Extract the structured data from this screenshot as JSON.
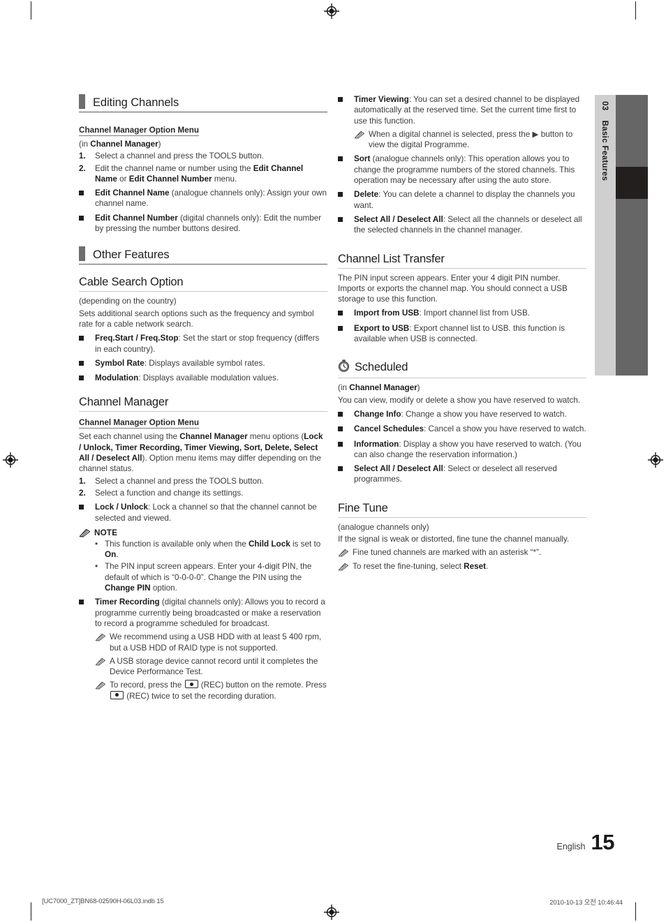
{
  "chapter_tab": {
    "number": "03",
    "label": "Basic Features"
  },
  "footer": {
    "language": "English",
    "page_number": "15",
    "print_file": "[UC7000_ZT]BN68-02590H-06L03.indb   15",
    "print_timestamp": "2010-10-13   오전 10:46:44"
  },
  "left_column": {
    "section1": {
      "heading": "Editing Channels",
      "opt_menu_title": "Channel Manager Option Menu",
      "in_line_pre": "(in ",
      "in_line_bold": "Channel Manager",
      "in_line_post": ")",
      "steps": [
        {
          "n": "1.",
          "html": "Select a channel and press the TOOLS button."
        },
        {
          "n": "2.",
          "html": "Edit the channel name or number using the <b>Edit Channel Name</b> or <b>Edit Channel Number</b> menu."
        }
      ],
      "bullets": [
        {
          "html": "<b>Edit Channel Name</b> (analogue channels only): Assign your own channel name."
        },
        {
          "html": "<b>Edit Channel Number</b> (digital channels only): Edit the number by pressing the number buttons desired."
        }
      ]
    },
    "section2": {
      "heading": "Other Features",
      "cable_search": {
        "title": "Cable Search Option",
        "paras": [
          "(depending on the country)",
          "Sets additional search options such as the frequency and symbol rate for a cable network search."
        ],
        "bullets": [
          {
            "html": "<b>Freq.Start / Freq.Stop</b>: Set the start or stop frequency (differs in each country)."
          },
          {
            "html": "<b>Symbol Rate</b>: Displays available symbol rates."
          },
          {
            "html": "<b>Modulation</b>: Displays available modulation values."
          }
        ]
      },
      "channel_manager": {
        "title": "Channel Manager",
        "opt_menu_title": "Channel Manager Option Menu",
        "intro_html": "Set each channel using the <b>Channel Manager</b> menu options (<b>Lock / Unlock, Timer Recording, Timer Viewing, Sort, Delete, Select All / Deselect All</b>). Option menu items may differ depending on the channel status.",
        "steps": [
          {
            "n": "1.",
            "html": "Select a channel and press the TOOLS button."
          },
          {
            "n": "2.",
            "html": "Select a function and change its settings."
          }
        ],
        "lock_bullet_html": "<b>Lock / Unlock</b>: Lock a channel so that the channel cannot be selected and viewed.",
        "note_label": "NOTE",
        "note_bullets": [
          {
            "html": "This function is available only when the <b>Child Lock</b> is set to <b>On</b>."
          },
          {
            "html": "The PIN input screen appears. Enter your 4-digit PIN, the default of which is “0-0-0-0”. Change the PIN using the <b>Change PIN</b> option."
          }
        ],
        "timer_recording_html": "<b>Timer Recording</b> (digital channels only): Allows you to record a programme currently being broadcasted or make a reservation to record a programme scheduled for broadcast.",
        "timer_recording_notes": [
          {
            "html": "We recommend using a USB HDD with at least 5 400 rpm, but a USB HDD of RAID type is not supported."
          },
          {
            "html": "A USB storage device cannot record until it completes the Device Performance Test."
          },
          {
            "html": "To record, press the <span class=\"reckey\"></span> (REC) button on the remote. Press <span class=\"reckey\"></span> (REC) twice to set the recording duration."
          }
        ]
      }
    }
  },
  "right_column": {
    "continued_bullets": [
      {
        "html": "<b>Timer Viewing</b>: You can set a desired channel to be displayed automatically at the reserved time. Set the current time first to use this function."
      },
      {
        "html": "<b>Sort</b> (analogue channels only): This operation allows you to change the programme numbers of the stored channels. This operation may be necessary after using the auto store."
      },
      {
        "html": "<b>Delete</b>: You can delete a channel to display the channels you want."
      },
      {
        "html": "<b>Select All / Deselect All</b>: Select all the channels or deselect all the selected channels in the channel manager."
      }
    ],
    "timer_viewing_note_html": "When a digital channel is selected, press the ▶ button to view the digital Programme.",
    "channel_list_transfer": {
      "title": "Channel List Transfer",
      "intro": "The PIN input screen appears. Enter your 4 digit PIN number. Imports or exports the channel map. You should connect a USB storage to use this function.",
      "bullets": [
        {
          "html": "<b>Import from USB</b>: Import channel list from USB."
        },
        {
          "html": "<b>Export to USB</b>: Export channel list to USB. this function is available when USB is connected."
        }
      ]
    },
    "scheduled": {
      "title": "Scheduled",
      "in_line_pre": "(in ",
      "in_line_bold": "Channel Manager",
      "in_line_post": ")",
      "intro": "You can view, modify or delete a show you have reserved to watch.",
      "bullets": [
        {
          "html": "<b>Change Info</b>: Change a show you have reserved to watch."
        },
        {
          "html": "<b>Cancel Schedules</b>: Cancel a show you have reserved to watch."
        },
        {
          "html": "<b>Information</b>: Display a show you have reserved to watch. (You can also change the reservation information.)"
        },
        {
          "html": "<b>Select All / Deselect All</b>: Select or deselect all reserved programmes."
        }
      ]
    },
    "fine_tune": {
      "title": "Fine Tune",
      "paras": [
        "(analogue channels only)",
        "If the signal is weak or distorted, fine tune the channel manually."
      ],
      "notes": [
        {
          "html": "Fine tuned channels are marked with an asterisk “*”."
        },
        {
          "html": "To reset the fine-tuning, select <b>Reset</b>."
        }
      ]
    }
  }
}
